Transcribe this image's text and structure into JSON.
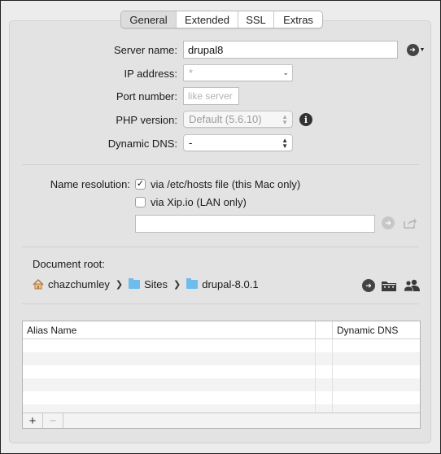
{
  "tabs": [
    {
      "label": "General",
      "active": true
    },
    {
      "label": "Extended",
      "active": false
    },
    {
      "label": "SSL",
      "active": false
    },
    {
      "label": "Extras",
      "active": false
    }
  ],
  "form": {
    "server_name_label": "Server name:",
    "server_name_value": "drupal8",
    "ip_label": "IP address:",
    "ip_value": "*",
    "port_label": "Port number:",
    "port_placeholder": "like server",
    "php_label": "PHP version:",
    "php_value": "Default (5.6.10)",
    "dns_label": "Dynamic DNS:",
    "dns_value": "-"
  },
  "name_resolution": {
    "label": "Name resolution:",
    "option_hosts": "via /etc/hosts file (this Mac only)",
    "option_hosts_checked": true,
    "option_xip": "via Xip.io (LAN only)",
    "option_xip_checked": false,
    "url_value": ""
  },
  "document_root": {
    "label": "Document root:",
    "path": [
      "chazchumley",
      "Sites",
      "drupal-8.0.1"
    ]
  },
  "alias_table": {
    "columns": [
      "Alias Name",
      "",
      "Dynamic DNS"
    ],
    "rows": [],
    "add_label": "+",
    "remove_label": "−"
  },
  "icons": {
    "server_action": "arrow-right-circle-icon",
    "php_info": "info-icon",
    "go": "arrow-right-circle-icon",
    "share": "share-icon",
    "home": "home-icon",
    "folder": "folder-icon",
    "open_folder": "open-folder-icon",
    "users": "users-icon"
  },
  "colors": {
    "folder_blue": "#6cbcec",
    "panel_bg": "#e3e3e3",
    "window_bg": "#ececec"
  }
}
